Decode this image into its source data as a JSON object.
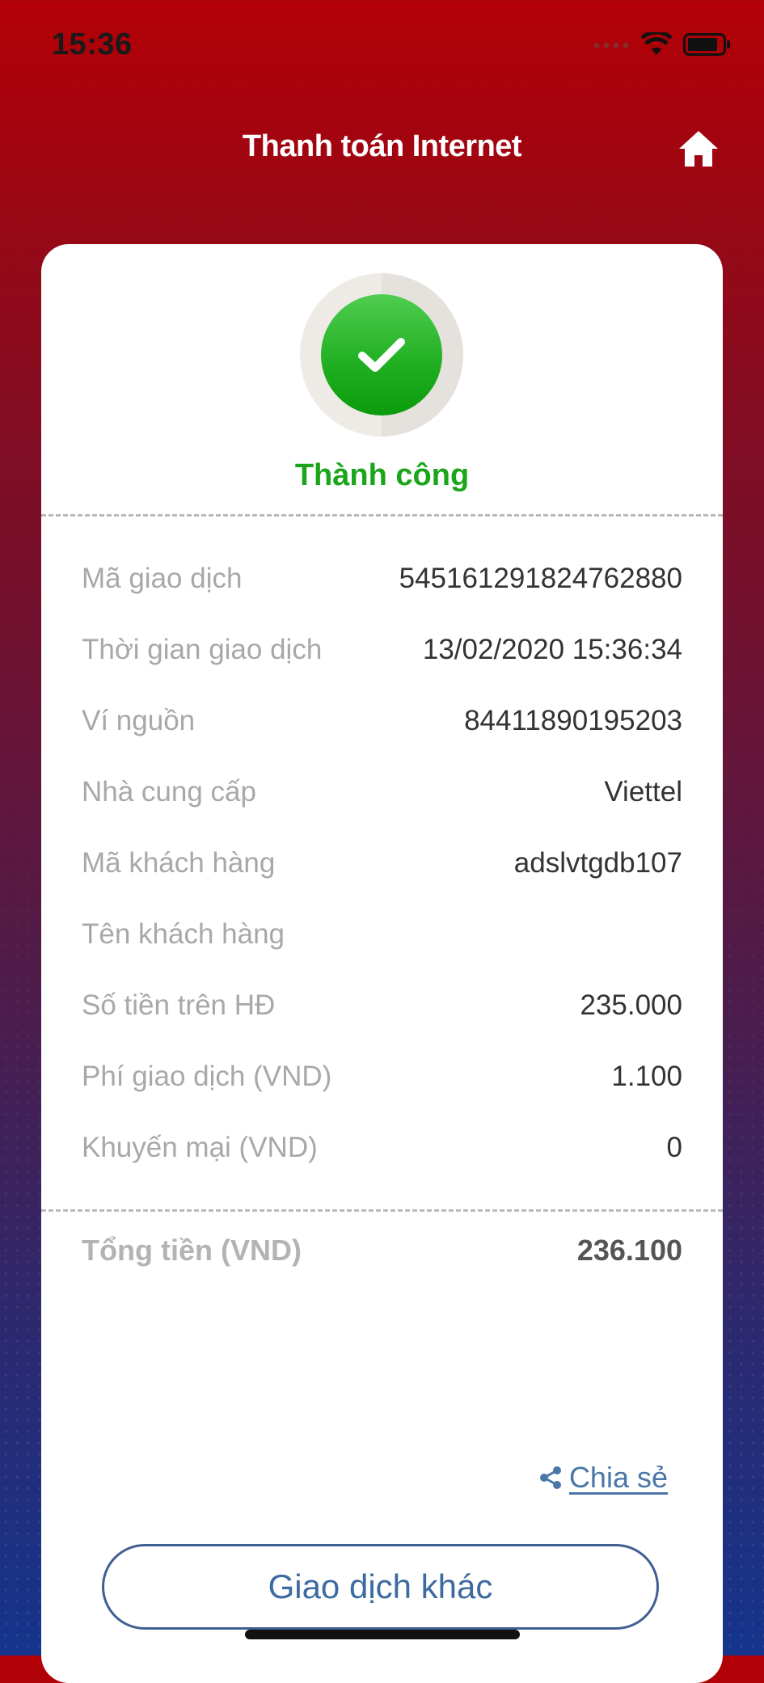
{
  "status_bar": {
    "time": "15:36"
  },
  "header": {
    "title": "Thanh toán Internet"
  },
  "result": {
    "status": "Thành công"
  },
  "details": [
    {
      "label": "Mã giao dịch",
      "value": "545161291824762880"
    },
    {
      "label": "Thời gian giao dịch",
      "value": "13/02/2020 15:36:34"
    },
    {
      "label": "Ví nguồn",
      "value": "84411890195203"
    },
    {
      "label": "Nhà cung cấp",
      "value": "Viettel"
    },
    {
      "label": "Mã khách hàng",
      "value": "adslvtgdb107"
    },
    {
      "label": "Tên khách hàng",
      "value": ""
    },
    {
      "label": "Số tiền trên HĐ",
      "value": "235.000"
    },
    {
      "label": "Phí giao dịch (VND)",
      "value": "1.100"
    },
    {
      "label": "Khuyến mại (VND)",
      "value": "0"
    }
  ],
  "total": {
    "label": "Tổng tiền (VND)",
    "value": "236.100"
  },
  "actions": {
    "share_label": "Chia sẻ",
    "other_transaction_label": "Giao dịch khác"
  },
  "colors": {
    "success": "#1aa51a",
    "link": "#4b77a8",
    "header_red": "#b30006"
  }
}
